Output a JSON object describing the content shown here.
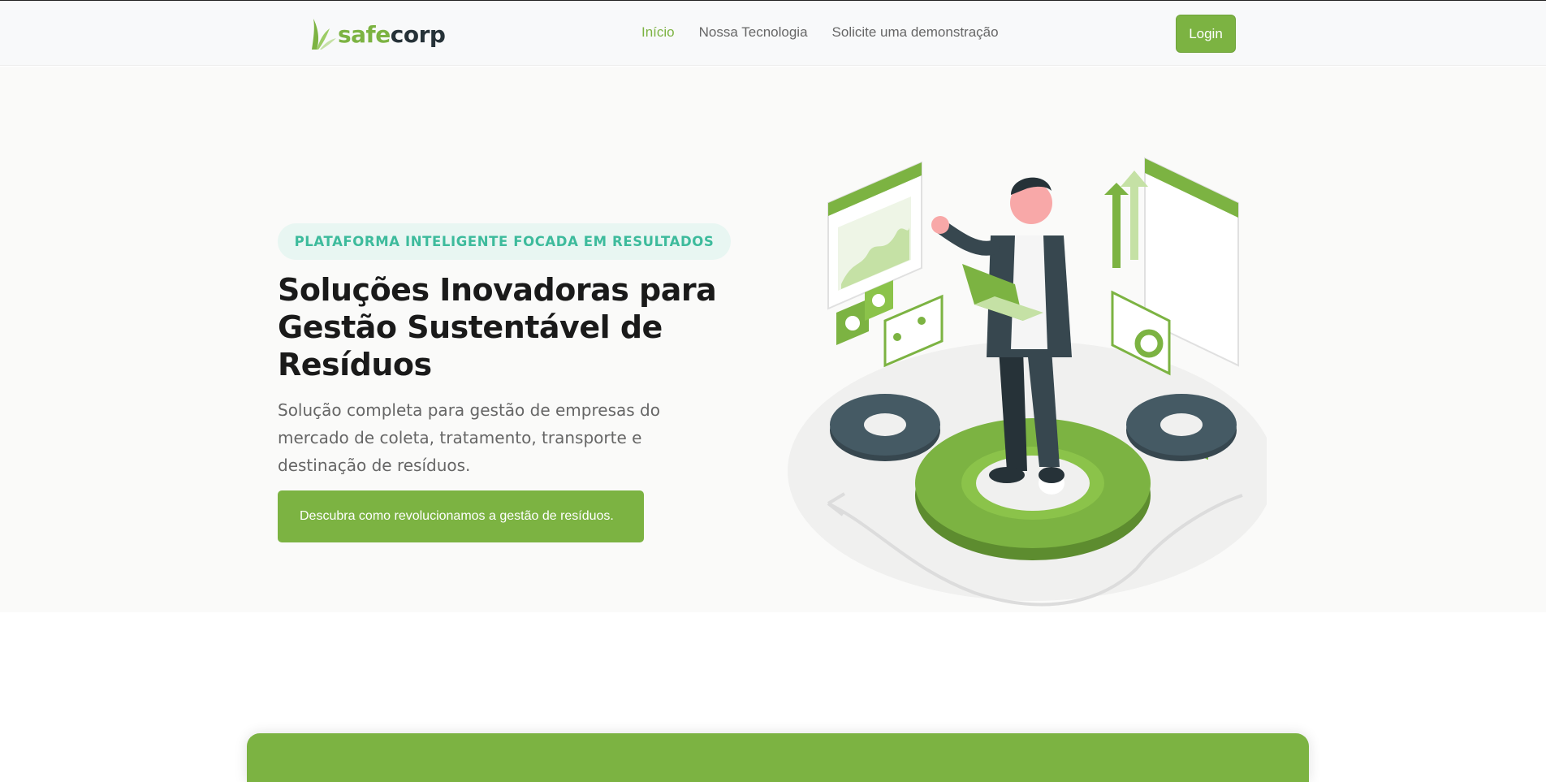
{
  "brand": {
    "name_part1": "safe",
    "name_part2": "corp",
    "accent": "#7cb342",
    "dark": "#263238"
  },
  "nav": {
    "links": [
      {
        "label": "Início",
        "active": true
      },
      {
        "label": "Nossa Tecnologia",
        "active": false
      },
      {
        "label": "Solicite uma demonstração",
        "active": false
      }
    ],
    "login_label": "Login"
  },
  "hero": {
    "tagline": "PLATAFORMA INTELIGENTE FOCADA EM RESULTADOS",
    "title_line1": "Soluções Inovadoras para",
    "title_line2": "Gestão Sustentável de",
    "title_line3": "Resíduos",
    "subtitle_line1": "Solução completa para gestão de empresas do",
    "subtitle_line2": "mercado de coleta, tratamento, transporte e",
    "subtitle_line3": "destinação de resíduos.",
    "cta_label": "Descubra como revolucionamos a gestão de resíduos.",
    "tagline_color": "#3dbb9c",
    "tagline_bg": "#e8f6f2"
  },
  "bottom_card": {
    "color": "#7cb342"
  }
}
